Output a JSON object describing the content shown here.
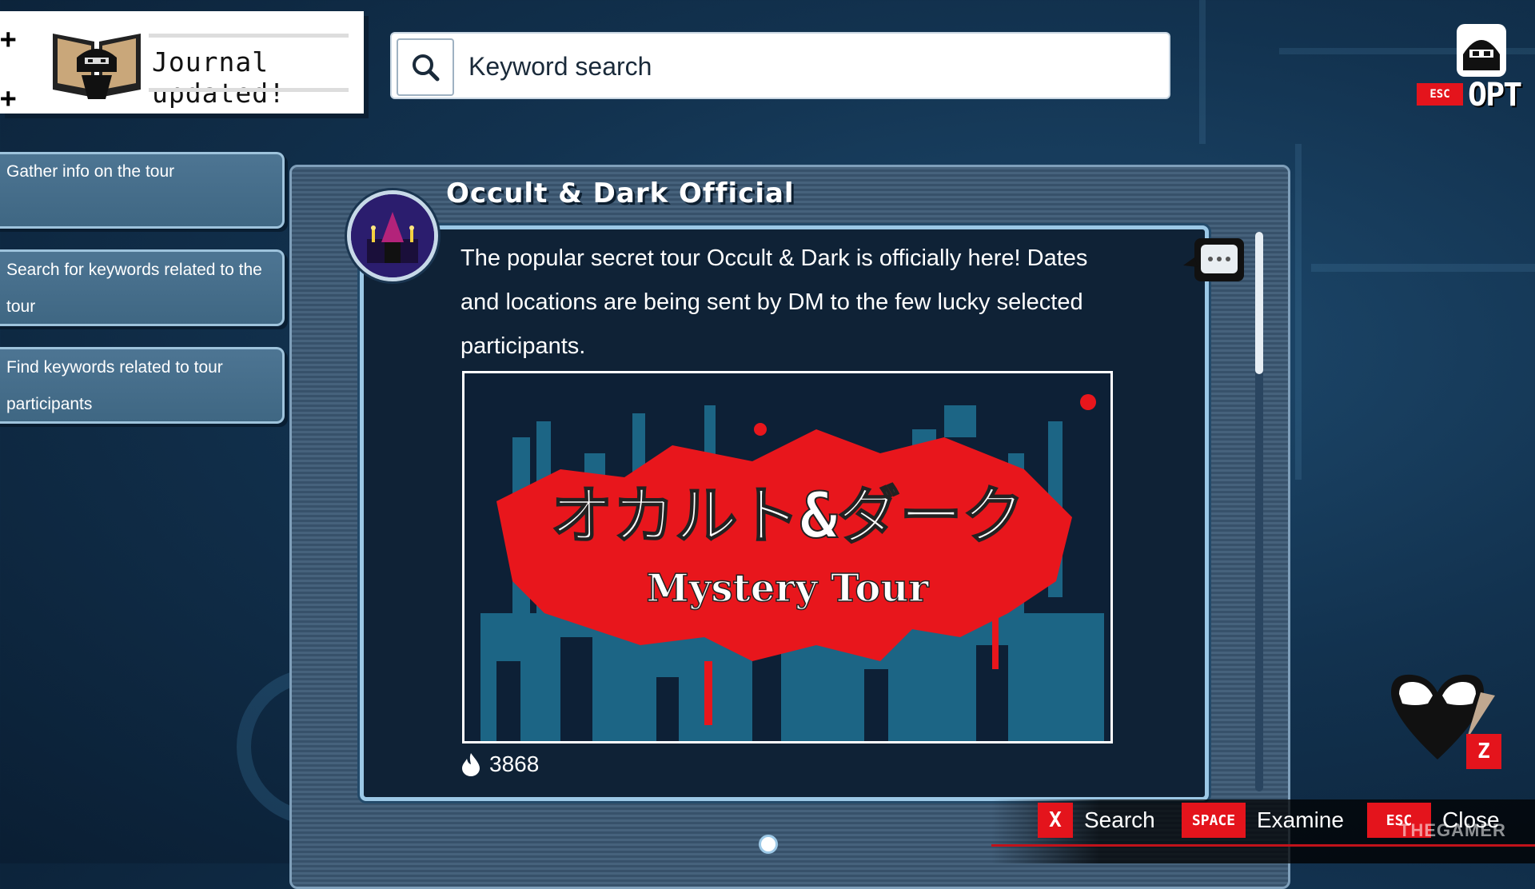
{
  "journal_toast": {
    "text": "Journal updated!"
  },
  "search": {
    "placeholder": "Keyword search"
  },
  "options": {
    "esc_key": "ESC",
    "label": "OPT"
  },
  "objectives": [
    {
      "label": "Gather info on the tour"
    },
    {
      "label": "Search for keywords related to the tour"
    },
    {
      "label": "Find keywords related to tour participants"
    }
  ],
  "post": {
    "account_name": "Occult & Dark Official",
    "text": "The popular secret tour Occult & Dark is officially here! Dates and locations are being sent by DM to the few lucky selected participants.",
    "image": {
      "title_jp": "オカルト&ダーク",
      "subtitle": "Mystery Tour"
    },
    "likes": "3868"
  },
  "controls": [
    {
      "key": "X",
      "label": "Search"
    },
    {
      "key": "SPACE",
      "label": "Examine"
    },
    {
      "key": "ESC",
      "label": "Close"
    }
  ],
  "shortcut": {
    "key": "Z"
  },
  "watermark": "THEGAMER",
  "colors": {
    "accent_red": "#e4141c",
    "panel_border": "#9cc8e6",
    "card_bg": "#0f2236",
    "splatter": "#e8161c"
  }
}
